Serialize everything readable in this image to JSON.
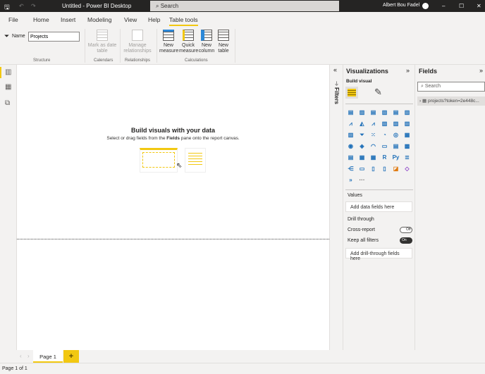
{
  "titlebar": {
    "title": "Untitled - Power BI Desktop",
    "search": "Search",
    "user": "Albert Bou Fadel"
  },
  "menu": [
    "File",
    "Home",
    "Insert",
    "Modeling",
    "View",
    "Help",
    "Table tools"
  ],
  "ribbon": {
    "name_label": "Name",
    "name_value": "Projects",
    "mark_date": "Mark as date table",
    "manage_rel": "Manage relationships",
    "new_measure": "New measure",
    "quick_measure": "Quick measure",
    "new_column": "New column",
    "new_table": "New table",
    "groups": {
      "structure": "Structure",
      "calendars": "Calendars",
      "relationships": "Relationships",
      "calculations": "Calculations"
    }
  },
  "canvas": {
    "heading": "Build visuals with your data",
    "sub_pre": "Select or drag fields from the ",
    "sub_bold": "Fields",
    "sub_post": " pane onto the report canvas."
  },
  "filters": {
    "label": "Filters"
  },
  "viz": {
    "title": "Visualizations",
    "build_visual": "Build visual",
    "r_label": "R",
    "py_label": "Py",
    "more": "···",
    "values_label": "Values",
    "values_placeholder": "Add data fields here",
    "drill_label": "Drill through",
    "cross_report": "Cross-report",
    "cross_state": "Off",
    "keep_filters": "Keep all filters",
    "keep_state": "On",
    "drill_placeholder": "Add drill-through fields here"
  },
  "fields": {
    "title": "Fields",
    "search_placeholder": "Search",
    "table": "projects?token=2e448c..."
  },
  "pages": {
    "tab": "Page 1",
    "add": "+"
  },
  "status": "Page 1 of 1"
}
